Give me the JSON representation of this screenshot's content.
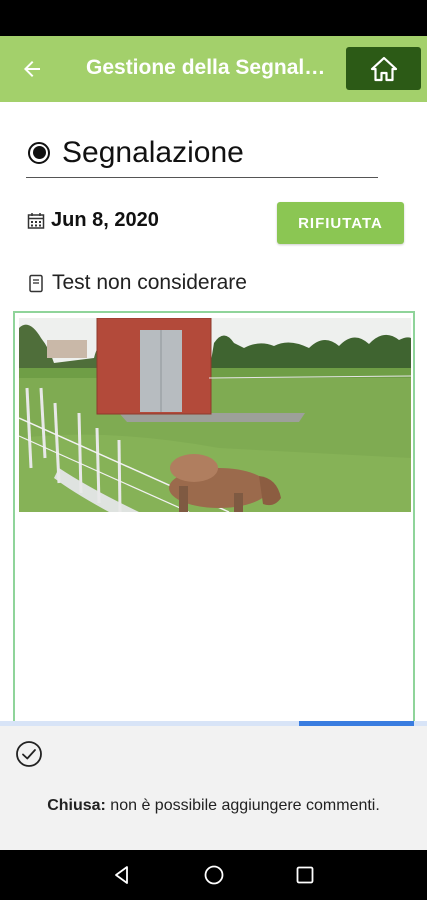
{
  "header": {
    "title": "Gestione della Segnalazione"
  },
  "report": {
    "type_label": "Segnalazione",
    "date": "Jun 8, 2020",
    "status": "RIFIUTATA",
    "description": "Test non considerare"
  },
  "upload_progress": 0.27,
  "footer": {
    "closed_bold": "Chiusa:",
    "closed_text": " non è possibile aggiungere commenti."
  },
  "colors": {
    "app_bar": "#a3d06b",
    "home_button": "#2c5a16",
    "status_button": "#8bc653",
    "image_border": "#8fd49a",
    "progress": "#3a7de0"
  },
  "icons": [
    "back-arrow-icon",
    "home-icon",
    "radio-selected-icon",
    "calendar-icon",
    "document-icon",
    "check-circle-icon",
    "nav-back-icon",
    "nav-home-icon",
    "nav-recents-icon"
  ]
}
